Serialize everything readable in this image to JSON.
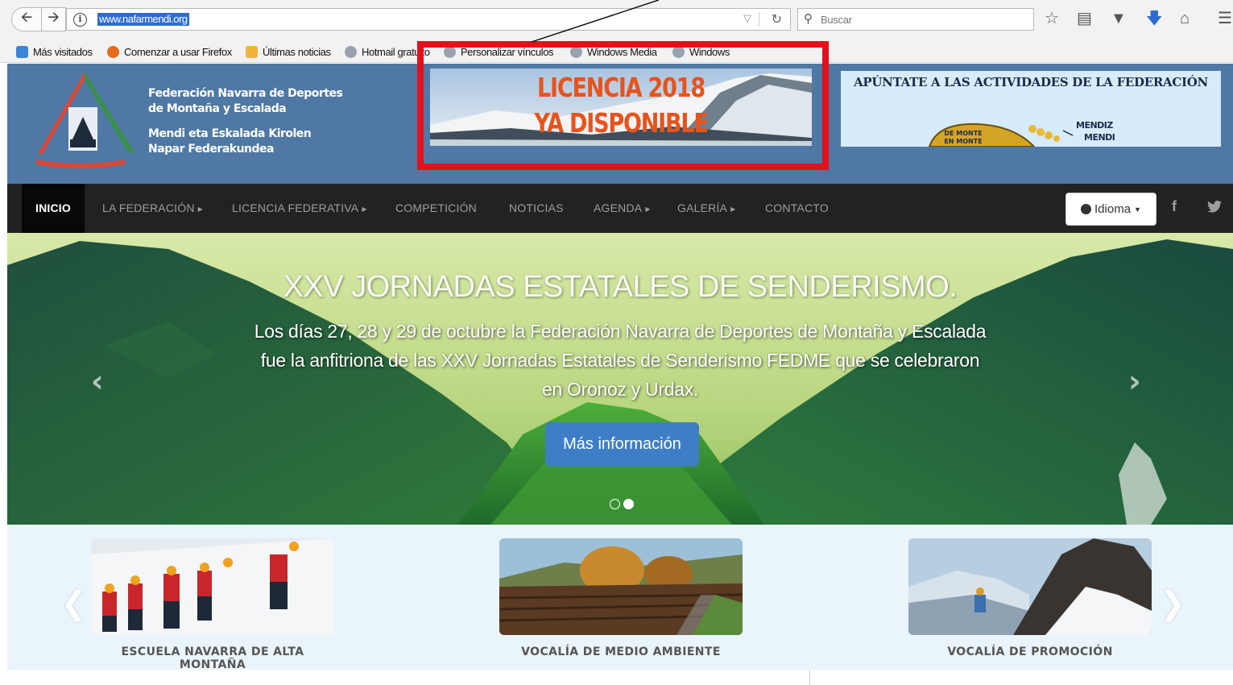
{
  "browser": {
    "url": "www.nafarmendi.org",
    "search_placeholder": "Buscar",
    "bookmarks": [
      {
        "label": "Más visitados"
      },
      {
        "label": "Comenzar a usar Firefox"
      },
      {
        "label": "Últimas noticias"
      },
      {
        "label": "Hotmail gratuito"
      },
      {
        "label": "Personalizar vínculos"
      },
      {
        "label": "Windows Media"
      },
      {
        "label": "Windows"
      }
    ],
    "icons": [
      "back-icon",
      "forward-icon",
      "info-icon",
      "reload-icon",
      "search-icon",
      "bookmark-star-icon",
      "reading-list-icon",
      "pocket-icon",
      "download-icon",
      "home-icon",
      "menu-icon"
    ]
  },
  "header": {
    "org_name_es_1": "Federación Navarra de Deportes",
    "org_name_es_2": "de Montaña y Escalada",
    "org_name_eu_1": "Mendi eta Eskalada Kirolen",
    "org_name_eu_2": "Napar Federakundea",
    "banner_licencia_line1": "LICENCIA 2018",
    "banner_licencia_line2": "YA DISPONIBLE",
    "banner_actividades_title": "APÚNTATE A LAS ACTIVIDADES DE LA FEDERACIÓN",
    "banner_actividades_sign_1": "DE MONTE",
    "banner_actividades_sign_2": "EN MONTE",
    "banner_actividades_mendiz": "MENDIZ",
    "banner_actividades_mendi": "MENDI",
    "colors": {
      "header_bg": "#4f78a4",
      "annotation_red": "#e4101b",
      "licencia_orange": "#e8531b"
    }
  },
  "nav": {
    "items": [
      {
        "label": "INICIO"
      },
      {
        "label": "LA FEDERACIÓN"
      },
      {
        "label": "LICENCIA FEDERATIVA"
      },
      {
        "label": "COMPETICIÓN"
      },
      {
        "label": "NOTICIAS"
      },
      {
        "label": "AGENDA"
      },
      {
        "label": "GALERÍA"
      },
      {
        "label": "CONTACTO"
      }
    ],
    "idioma_label": "Idioma",
    "facebook_glyph": "f",
    "colors": {
      "nav_bg": "#222222",
      "nav_active": "#080808"
    }
  },
  "hero": {
    "title": "XXV JORNADAS ESTATALES DE SENDERISMO.",
    "description": "Los días 27, 28 y 29 de octubre la Federación Navarra de Deportes de Montaña y Escalada fue la anfitriona de las XXV Jornadas Estatales de Senderismo FEDME que se celebraron en Oronoz y Urdax.",
    "button_label": "Más información",
    "slide_count": 2,
    "active_slide": 2,
    "colors": {
      "button_bg": "#3d7ec7"
    }
  },
  "sections": {
    "cards": [
      {
        "label": "ESCUELA NAVARRA DE ALTA MONTAÑA"
      },
      {
        "label": "VOCALÍA DE MEDIO AMBIENTE"
      },
      {
        "label": "VOCALÍA DE PROMOCIÓN"
      }
    ]
  }
}
